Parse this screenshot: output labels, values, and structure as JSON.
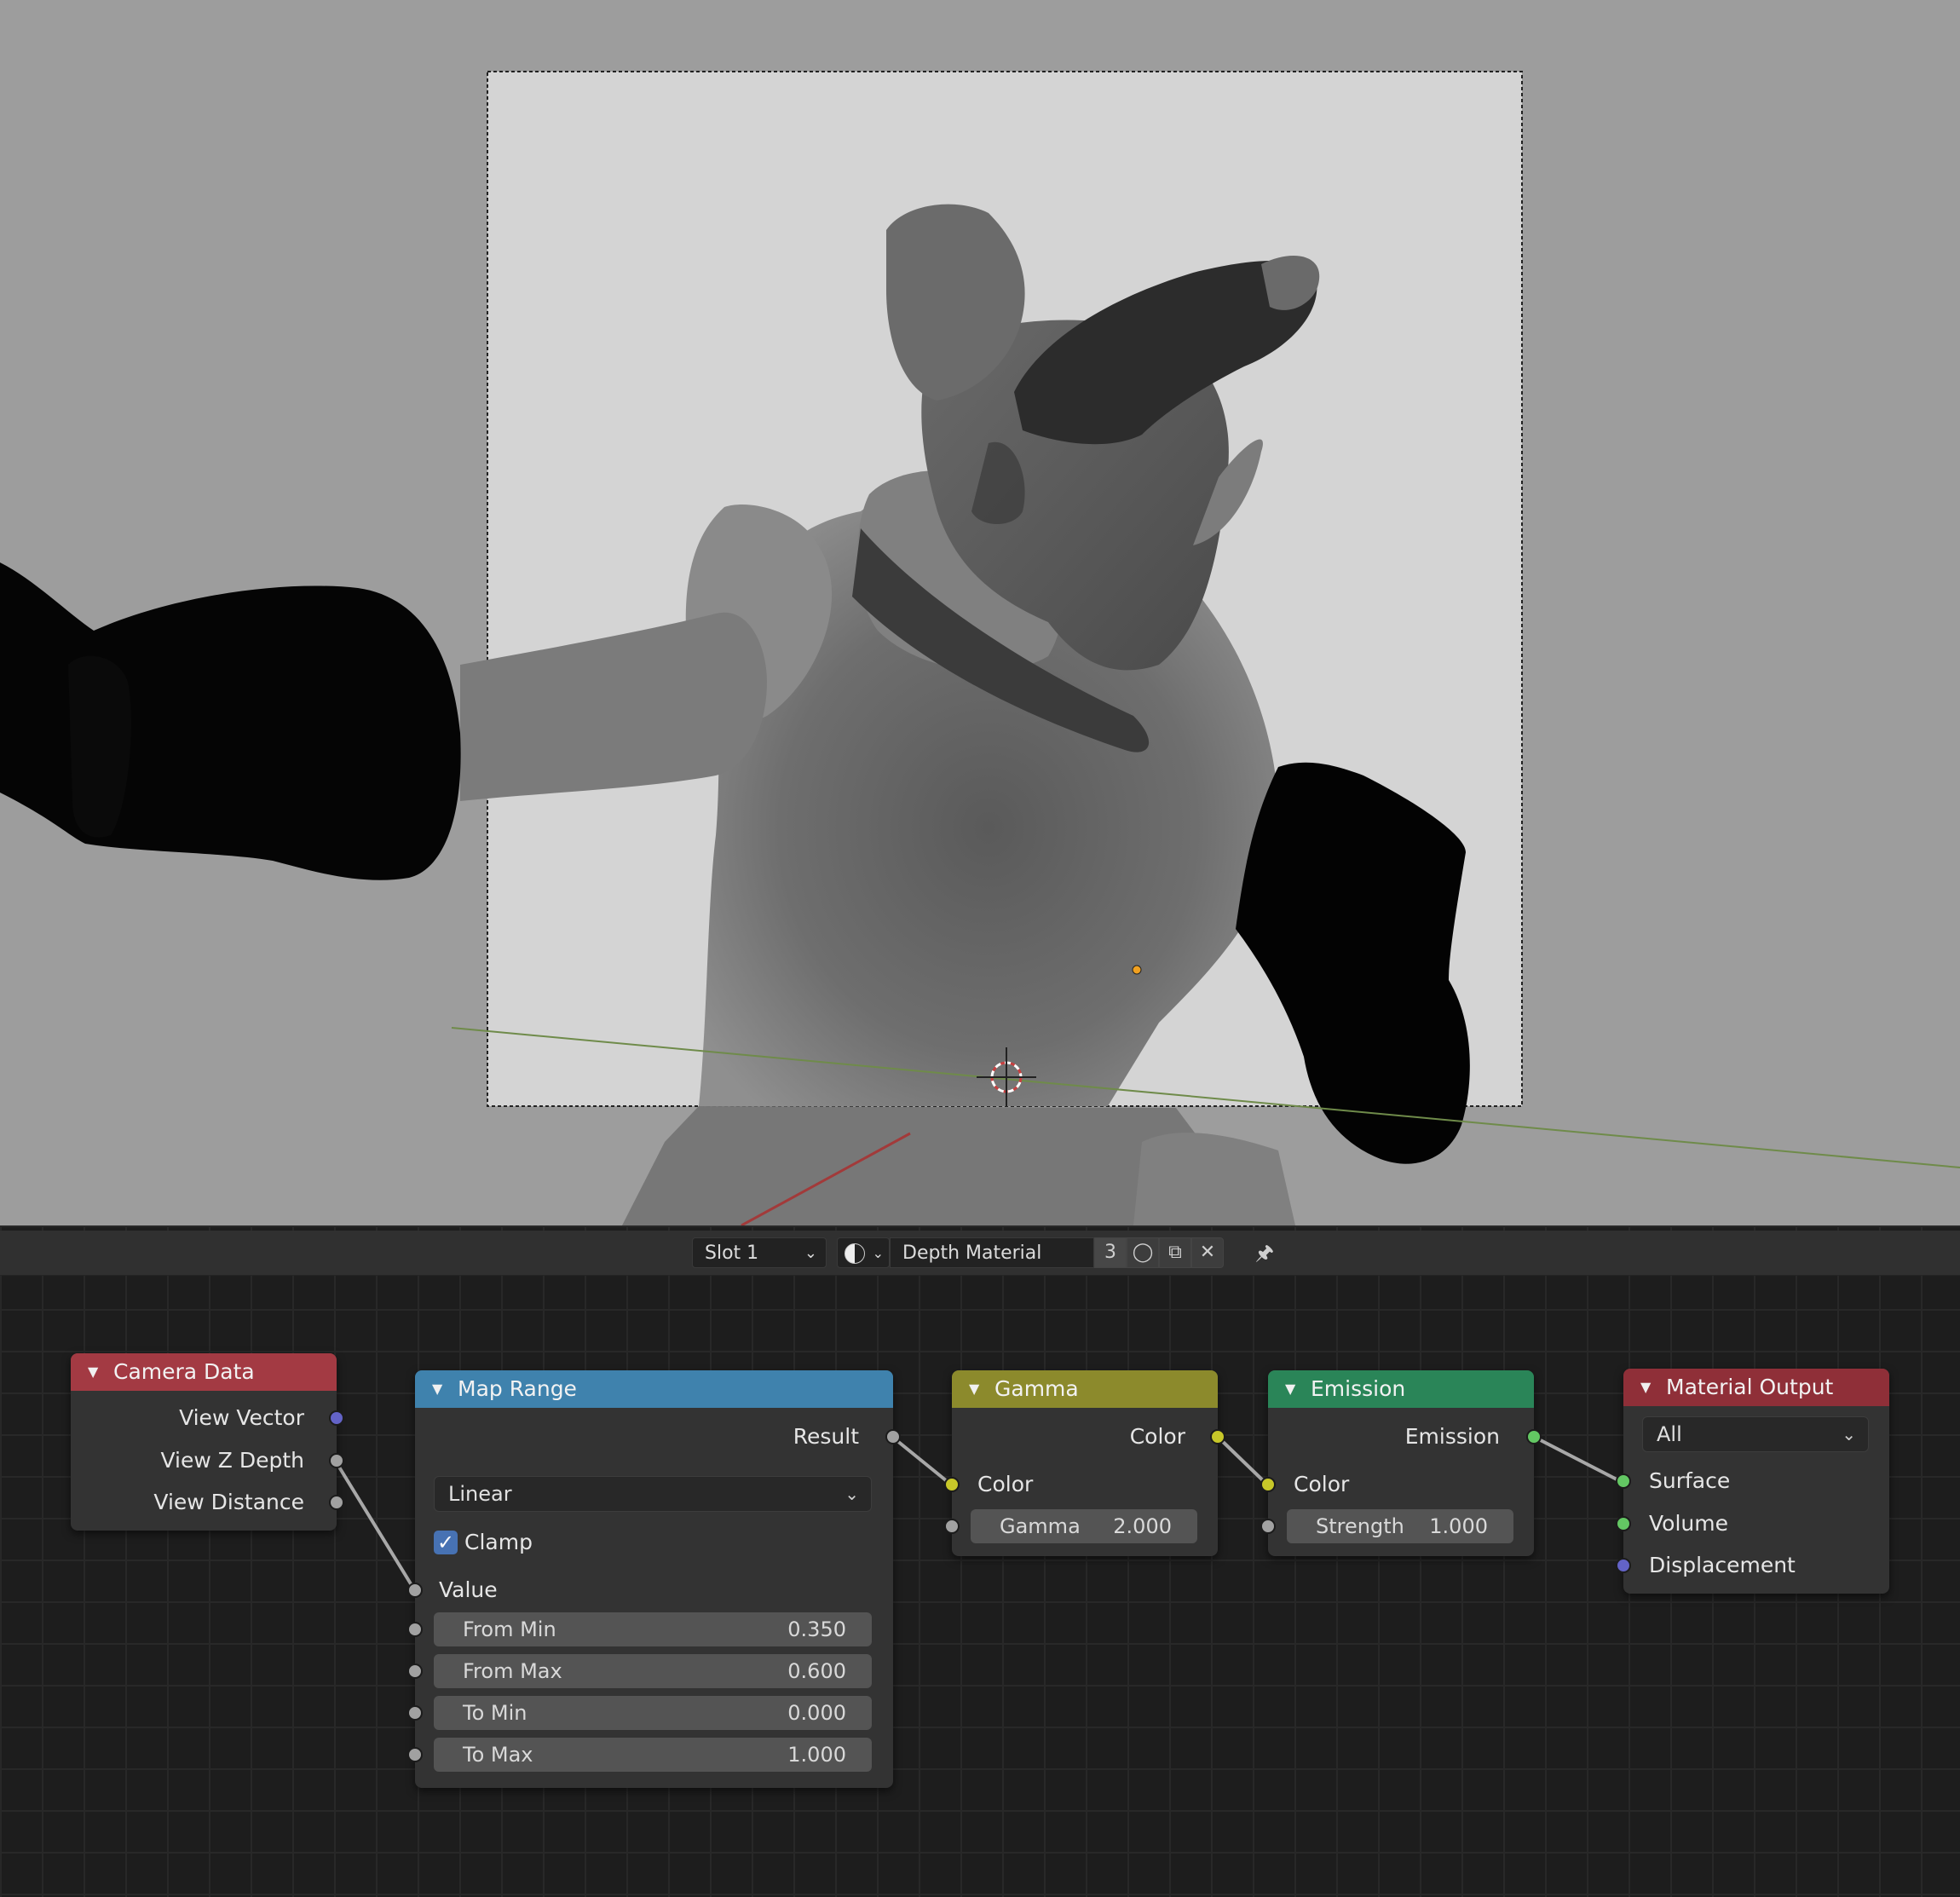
{
  "material_header": {
    "slot": "Slot 1",
    "material_name": "Depth Material",
    "user_count": "3"
  },
  "nodes": {
    "camera_data": {
      "title": "Camera Data",
      "header_color": "#a33a43",
      "outputs": [
        "View Vector",
        "View Z Depth",
        "View Distance"
      ]
    },
    "map_range": {
      "title": "Map Range",
      "header_color": "#3f82ad",
      "output": "Result",
      "interpolation": "Linear",
      "clamp_label": "Clamp",
      "clamp_checked": true,
      "input_value": "Value",
      "fields": [
        {
          "label": "From Min",
          "value": "0.350"
        },
        {
          "label": "From Max",
          "value": "0.600"
        },
        {
          "label": "To Min",
          "value": "0.000"
        },
        {
          "label": "To Max",
          "value": "1.000"
        }
      ]
    },
    "gamma": {
      "title": "Gamma",
      "header_color": "#8c8a2c",
      "output": "Color",
      "input": "Color",
      "field": {
        "label": "Gamma",
        "value": "2.000"
      }
    },
    "emission": {
      "title": "Emission",
      "header_color": "#2a8558",
      "output": "Emission",
      "input": "Color",
      "field": {
        "label": "Strength",
        "value": "1.000"
      }
    },
    "material_output": {
      "title": "Material Output",
      "header_color": "#8f2f38",
      "target": "All",
      "inputs": [
        "Surface",
        "Volume",
        "Displacement"
      ]
    }
  },
  "socket_colors": {
    "vector": "#6363c7",
    "float": "#a1a1a1",
    "color": "#c7c729",
    "shader": "#63c763"
  },
  "icons": [
    "dropdown-chevron-icon",
    "material-sphere-icon",
    "fake-user-shield-icon",
    "duplicate-icon",
    "close-icon",
    "pin-icon",
    "checkmark-icon",
    "collapse-triangle-icon",
    "3d-cursor-icon"
  ]
}
